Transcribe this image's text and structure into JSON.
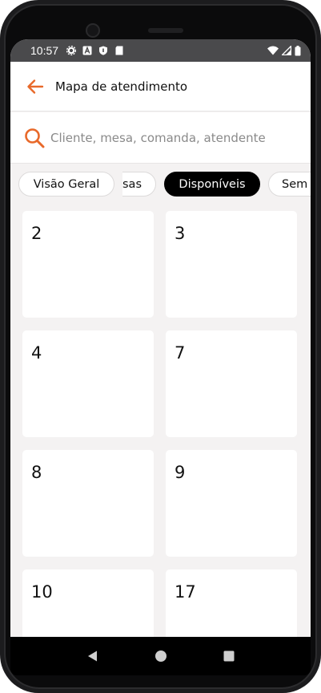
{
  "status_bar": {
    "time": "10:57",
    "icons": [
      "gear-icon",
      "a-icon",
      "shield-icon",
      "sd-card-icon"
    ],
    "right_icons": [
      "wifi-icon",
      "signal-icon",
      "battery-icon"
    ]
  },
  "header": {
    "title": "Mapa de atendimento",
    "back_icon": "arrow-left-icon"
  },
  "search": {
    "placeholder": "Cliente, mesa, comanda, atendente",
    "value": "",
    "icon": "search-icon"
  },
  "filters": [
    {
      "label": "Visão Geral",
      "active": false
    },
    {
      "label": "sas",
      "active": false
    },
    {
      "label": "Disponíveis",
      "active": true
    },
    {
      "label": "Sem",
      "active": false
    }
  ],
  "tables": [
    "2",
    "3",
    "4",
    "7",
    "8",
    "9",
    "10",
    "17"
  ],
  "nav": [
    "back-triangle-icon",
    "home-circle-icon",
    "recents-square-icon"
  ],
  "colors": {
    "accent": "#e8692a",
    "chip_active_bg": "#000000",
    "screen_bg": "#f4f2f2"
  }
}
